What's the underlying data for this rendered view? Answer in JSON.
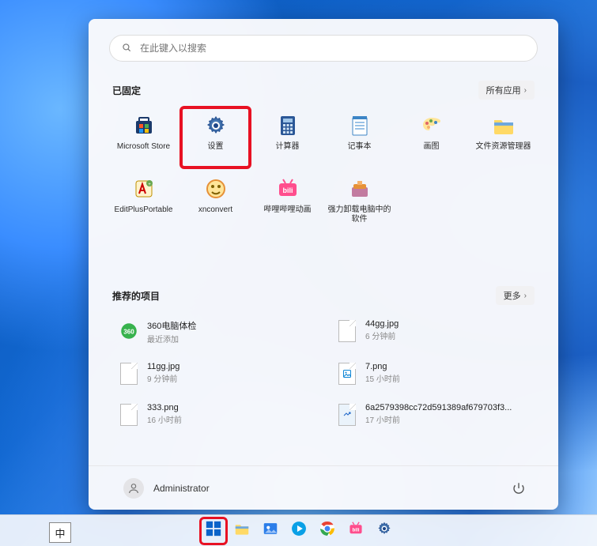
{
  "search": {
    "placeholder": "在此键入以搜索"
  },
  "pinned": {
    "header": "已固定",
    "all_apps": "所有应用",
    "items": [
      {
        "label": "Microsoft Store",
        "icon": "store",
        "highlight": false
      },
      {
        "label": "设置",
        "icon": "settings",
        "highlight": true
      },
      {
        "label": "计算器",
        "icon": "calculator",
        "highlight": false
      },
      {
        "label": "记事本",
        "icon": "notepad",
        "highlight": false
      },
      {
        "label": "画图",
        "icon": "paint",
        "highlight": false
      },
      {
        "label": "文件资源管理器",
        "icon": "explorer",
        "highlight": false
      },
      {
        "label": "EditPlusPortable",
        "icon": "editplus",
        "highlight": false
      },
      {
        "label": "xnconvert",
        "icon": "xnconvert",
        "highlight": false
      },
      {
        "label": "哔哩哔哩动画",
        "icon": "bilibili",
        "highlight": false
      },
      {
        "label": "强力卸载电脑中的软件",
        "icon": "uninstall",
        "highlight": false
      }
    ]
  },
  "recommended": {
    "header": "推荐的项目",
    "more": "更多",
    "items": [
      {
        "title": "360电脑体检",
        "sub": "最近添加",
        "icon": "360"
      },
      {
        "title": "44gg.jpg",
        "sub": "6 分钟前",
        "icon": "file"
      },
      {
        "title": "11gg.jpg",
        "sub": "9 分钟前",
        "icon": "file"
      },
      {
        "title": "7.png",
        "sub": "15 小时前",
        "icon": "png"
      },
      {
        "title": "333.png",
        "sub": "16 小时前",
        "icon": "file"
      },
      {
        "title": "6a2579398cc72d591389af679703f3...",
        "sub": "17 小时前",
        "icon": "png2"
      }
    ]
  },
  "footer": {
    "user": "Administrator"
  },
  "taskbar": {
    "ime": "中",
    "items": [
      {
        "name": "start",
        "icon": "win",
        "highlight": true
      },
      {
        "name": "explorer",
        "icon": "explorer",
        "highlight": false
      },
      {
        "name": "photos",
        "icon": "photos",
        "highlight": false
      },
      {
        "name": "ql",
        "icon": "ql",
        "highlight": false
      },
      {
        "name": "chrome",
        "icon": "chrome",
        "highlight": false
      },
      {
        "name": "bilibili",
        "icon": "bilibili",
        "highlight": false
      },
      {
        "name": "settings",
        "icon": "settings",
        "highlight": false
      }
    ]
  }
}
